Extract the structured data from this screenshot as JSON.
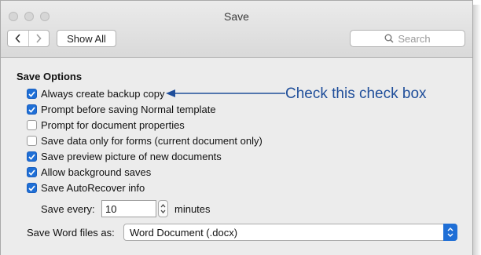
{
  "window": {
    "title": "Save"
  },
  "toolbar": {
    "show_all_label": "Show All",
    "search_placeholder": "Search"
  },
  "save_options": {
    "heading": "Save Options",
    "options": [
      {
        "label": "Always create backup copy",
        "checked": true
      },
      {
        "label": "Prompt before saving Normal template",
        "checked": true
      },
      {
        "label": "Prompt for document properties",
        "checked": false
      },
      {
        "label": "Save data only for forms (current document only)",
        "checked": false
      },
      {
        "label": "Save preview picture of new documents",
        "checked": true
      },
      {
        "label": "Allow background saves",
        "checked": true
      },
      {
        "label": "Save AutoRecover info",
        "checked": true
      }
    ],
    "save_every_label": "Save every:",
    "save_every_value": "10",
    "minutes_label": "minutes",
    "format_label": "Save Word files as:",
    "format_value": "Word Document (.docx)"
  },
  "annotation": {
    "text": "Check this check box"
  },
  "colors": {
    "accent": "#1f6fd6",
    "annotation": "#1f4e9a"
  }
}
